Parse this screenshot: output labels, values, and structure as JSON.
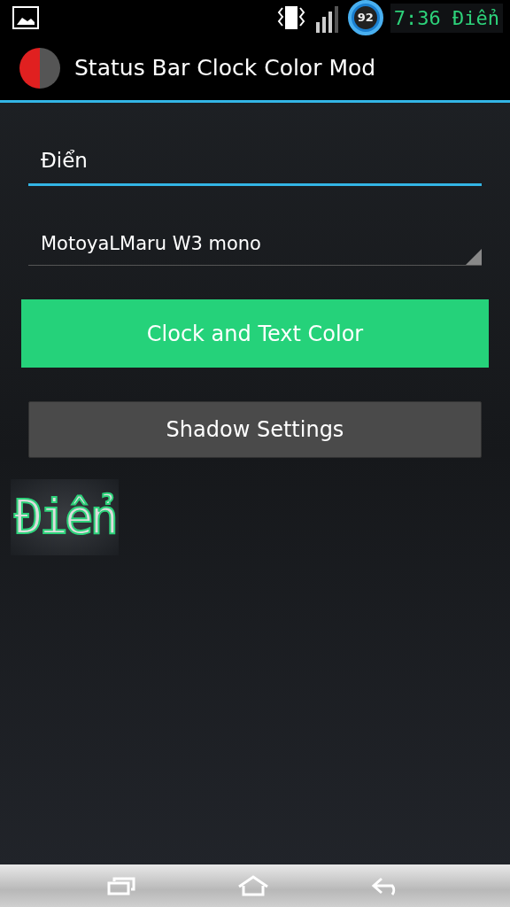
{
  "status_bar": {
    "battery": "92",
    "clock": "7:36 Điển"
  },
  "app_bar": {
    "title": "Status Bar Clock Color Mod"
  },
  "text_field": {
    "value": "Điển"
  },
  "font_spinner": {
    "value": "MotoyaLMaru W3 mono"
  },
  "buttons": [
    {
      "label": "Clock and Text Color",
      "kind": "accent"
    },
    {
      "label": "Shadow Settings",
      "kind": "default"
    }
  ],
  "preview": {
    "text": "Điển"
  }
}
